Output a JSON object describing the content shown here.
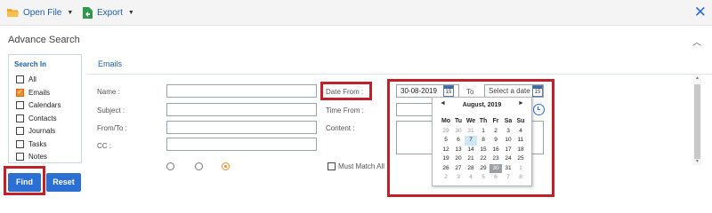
{
  "toolbar": {
    "open_file_label": "Open File",
    "export_label": "Export"
  },
  "panel": {
    "title": "Advance Search"
  },
  "search_in": {
    "heading": "Search In",
    "items": [
      {
        "label": "All",
        "checked": false
      },
      {
        "label": "Emails",
        "checked": true
      },
      {
        "label": "Calendars",
        "checked": false
      },
      {
        "label": "Contacts",
        "checked": false
      },
      {
        "label": "Journals",
        "checked": false
      },
      {
        "label": "Tasks",
        "checked": false
      },
      {
        "label": "Notes",
        "checked": false
      }
    ]
  },
  "tabs": {
    "emails": "Emails"
  },
  "form": {
    "name_label": "Name :",
    "subject_label": "Subject :",
    "fromto_label": "From/To :",
    "cc_label": "CC :",
    "date_from_label": "Date From :",
    "time_from_label": "Time From :",
    "content_label": "Content :",
    "to_label": "To",
    "date_from_value": "30-08-2019",
    "date_to_placeholder": "Select a date",
    "calendar_icon_day": "15",
    "match_all_label": "Must Match All"
  },
  "calendar": {
    "title": "August, 2019",
    "prev": "◄",
    "next": "►",
    "day_headers": [
      "Mo",
      "Tu",
      "We",
      "Th",
      "Fr",
      "Sa",
      "Su"
    ],
    "weeks": [
      [
        "29",
        "30",
        "31",
        "1",
        "2",
        "3",
        "4"
      ],
      [
        "5",
        "6",
        "7",
        "8",
        "9",
        "10",
        "11"
      ],
      [
        "12",
        "13",
        "14",
        "15",
        "16",
        "17",
        "18"
      ],
      [
        "19",
        "20",
        "21",
        "22",
        "23",
        "24",
        "25"
      ],
      [
        "26",
        "27",
        "28",
        "29",
        "30",
        "31",
        "1"
      ],
      [
        "2",
        "3",
        "4",
        "5",
        "6",
        "7",
        "8"
      ]
    ],
    "today": "7",
    "selected": "30"
  },
  "buttons": {
    "find": "Find",
    "reset": "Reset"
  },
  "colors": {
    "accent": "#2a6fd1",
    "link": "#1f5fa8",
    "checkbox_on": "#f08a24",
    "highlight_box": "#c0202a"
  }
}
